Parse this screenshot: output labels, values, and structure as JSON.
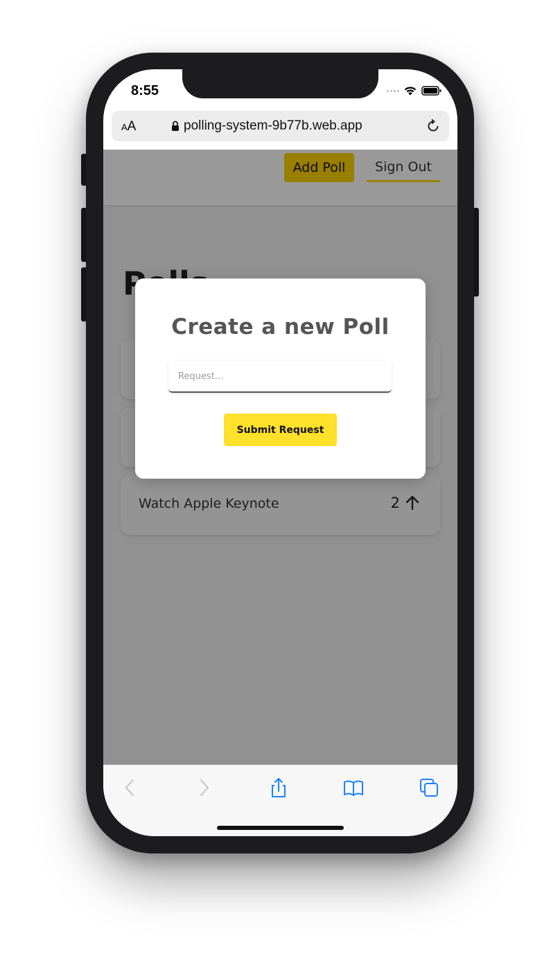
{
  "status_bar": {
    "time": "8:55"
  },
  "browser": {
    "text_size_label_small": "A",
    "text_size_label_large": "A",
    "url": "polling-system-9b77b.web.app"
  },
  "header": {
    "add_poll_label": "Add Poll",
    "sign_out_label": "Sign Out"
  },
  "page": {
    "title": "Polls"
  },
  "polls": [
    {
      "label": "",
      "count": ""
    },
    {
      "label": "",
      "count": ""
    },
    {
      "label": "Watch Apple Keynote",
      "count": "2"
    }
  ],
  "modal": {
    "title": "Create a new Poll",
    "input_placeholder": "Request...",
    "input_value": "",
    "submit_label": "Submit Request"
  },
  "colors": {
    "accent": "#ffd400",
    "submit": "#ffe02a",
    "safari_blue": "#1a82fb"
  },
  "icons": {
    "back": "chevron-left-icon",
    "forward": "chevron-right-icon",
    "share": "share-icon",
    "bookmarks": "book-icon",
    "tabs": "tabs-icon",
    "reload": "reload-icon",
    "lock": "lock-icon",
    "upvote": "arrow-up-icon"
  }
}
